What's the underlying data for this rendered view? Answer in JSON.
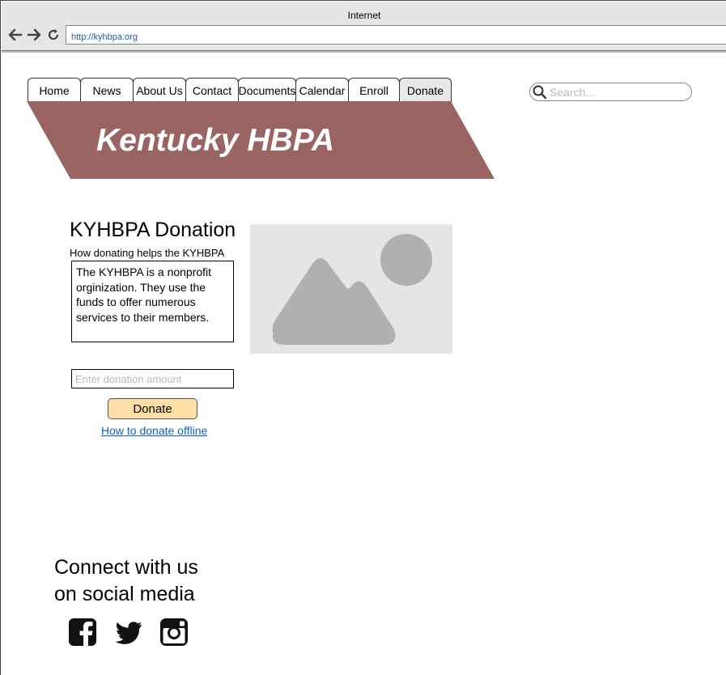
{
  "browser": {
    "title": "Internet",
    "url": "http://kyhbpa.org"
  },
  "nav": {
    "tabs": [
      {
        "label": "Home"
      },
      {
        "label": "News"
      },
      {
        "label": "About Us"
      },
      {
        "label": "Contact"
      },
      {
        "label": "Documents"
      },
      {
        "label": "Calendar"
      },
      {
        "label": "Enroll"
      },
      {
        "label": "Donate",
        "active": true
      }
    ]
  },
  "banner": {
    "title": "Kentucky HBPA",
    "color": "#9a6462"
  },
  "search": {
    "placeholder": "Search..."
  },
  "donation": {
    "heading": "KYHBPA Donation",
    "subheading": "How donating helps the KYHBPA",
    "description": "The KYHBPA is a nonprofit orginization. They use the funds to offer numerous services to their members.",
    "amount_placeholder": "Enter donation amount",
    "button_label": "Donate",
    "offline_link": "How to donate offline"
  },
  "social": {
    "heading_line1": "Connect with us",
    "heading_line2": "on social media",
    "icons": [
      "facebook-icon",
      "twitter-icon",
      "instagram-icon"
    ]
  },
  "colors": {
    "donate_button": "#ffdfa6",
    "link": "#0b62c4"
  }
}
